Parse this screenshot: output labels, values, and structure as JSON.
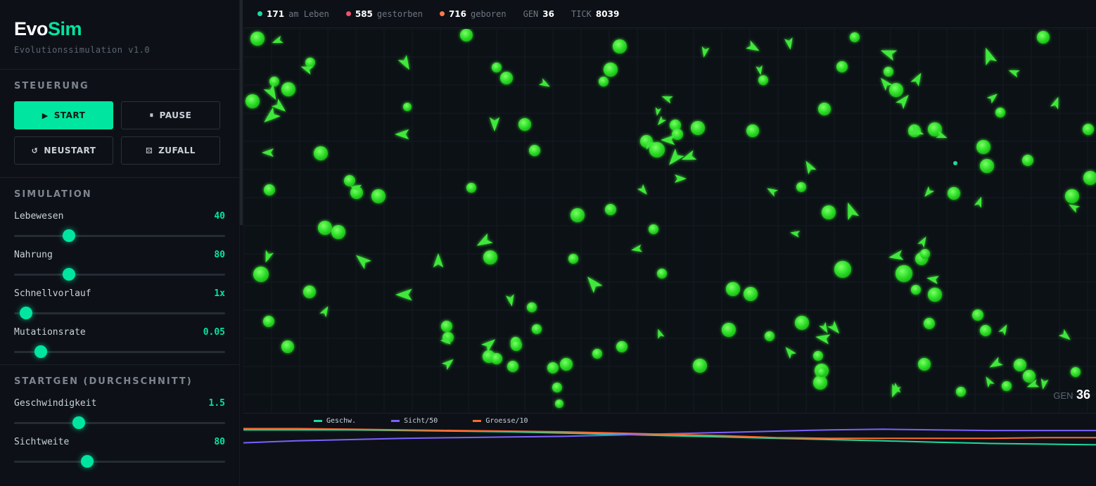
{
  "app": {
    "name_a": "Evo",
    "name_b": "Sim",
    "subtitle": "Evolutionssimulation v1.0"
  },
  "controls": {
    "heading": "STEUERUNG",
    "start": "START",
    "pause": "PAUSE",
    "restart": "NEUSTART",
    "random": "ZUFALL"
  },
  "simulation": {
    "heading": "SIMULATION",
    "sliders": [
      {
        "label": "Lebewesen",
        "value": "40",
        "fraction": 0.25
      },
      {
        "label": "Nahrung",
        "value": "80",
        "fraction": 0.25
      },
      {
        "label": "Schnellvorlauf",
        "value": "1x",
        "fraction": 0.03
      },
      {
        "label": "Mutationsrate",
        "value": "0.05",
        "fraction": 0.105
      }
    ]
  },
  "startgen": {
    "heading": "STARTGEN (DURCHSCHNITT)",
    "sliders": [
      {
        "label": "Geschwindigkeit",
        "value": "1.5",
        "fraction": 0.3
      },
      {
        "label": "Sichtweite",
        "value": "80",
        "fraction": 0.345
      }
    ]
  },
  "stats": {
    "alive": "171",
    "alive_label": "am Leben",
    "died": "585",
    "died_label": "gestorben",
    "born": "716",
    "born_label": "geboren",
    "gen_label": "GEN",
    "gen": "36",
    "tick_label": "TICK",
    "tick": "8039"
  },
  "world": {
    "gen_label": "GEN",
    "gen": "36"
  },
  "legend": {
    "speed": "Geschw.",
    "sight": "Sicht/50",
    "size": "Groesse/10"
  },
  "colors": {
    "accent": "#00e6a0",
    "alive": "#1fd9a0",
    "died": "#f0506e",
    "born": "#ff7a45",
    "creature": "#3ee83a",
    "speed_line": "#1fd9a0",
    "sight_line": "#7b61ff",
    "size_line": "#ff6a2f"
  },
  "chart_data": {
    "type": "line",
    "series": [
      {
        "name": "Geschw.",
        "values": [
          1.5,
          1.5,
          1.5,
          1.49,
          1.48,
          1.47,
          1.45,
          1.43,
          1.41,
          1.39,
          1.37,
          1.35,
          1.33,
          1.31,
          1.29,
          1.28,
          1.27
        ]
      },
      {
        "name": "Sicht/50",
        "values": [
          1.3,
          1.33,
          1.35,
          1.37,
          1.38,
          1.39,
          1.4,
          1.42,
          1.44,
          1.46,
          1.48,
          1.5,
          1.51,
          1.5,
          1.49,
          1.49,
          1.49
        ]
      },
      {
        "name": "Groesse/10",
        "values": [
          1.52,
          1.52,
          1.51,
          1.5,
          1.49,
          1.48,
          1.47,
          1.45,
          1.43,
          1.41,
          1.38,
          1.37,
          1.37,
          1.37,
          1.37,
          1.38,
          1.38
        ]
      }
    ],
    "ylim": [
      1.1,
      1.6
    ]
  }
}
